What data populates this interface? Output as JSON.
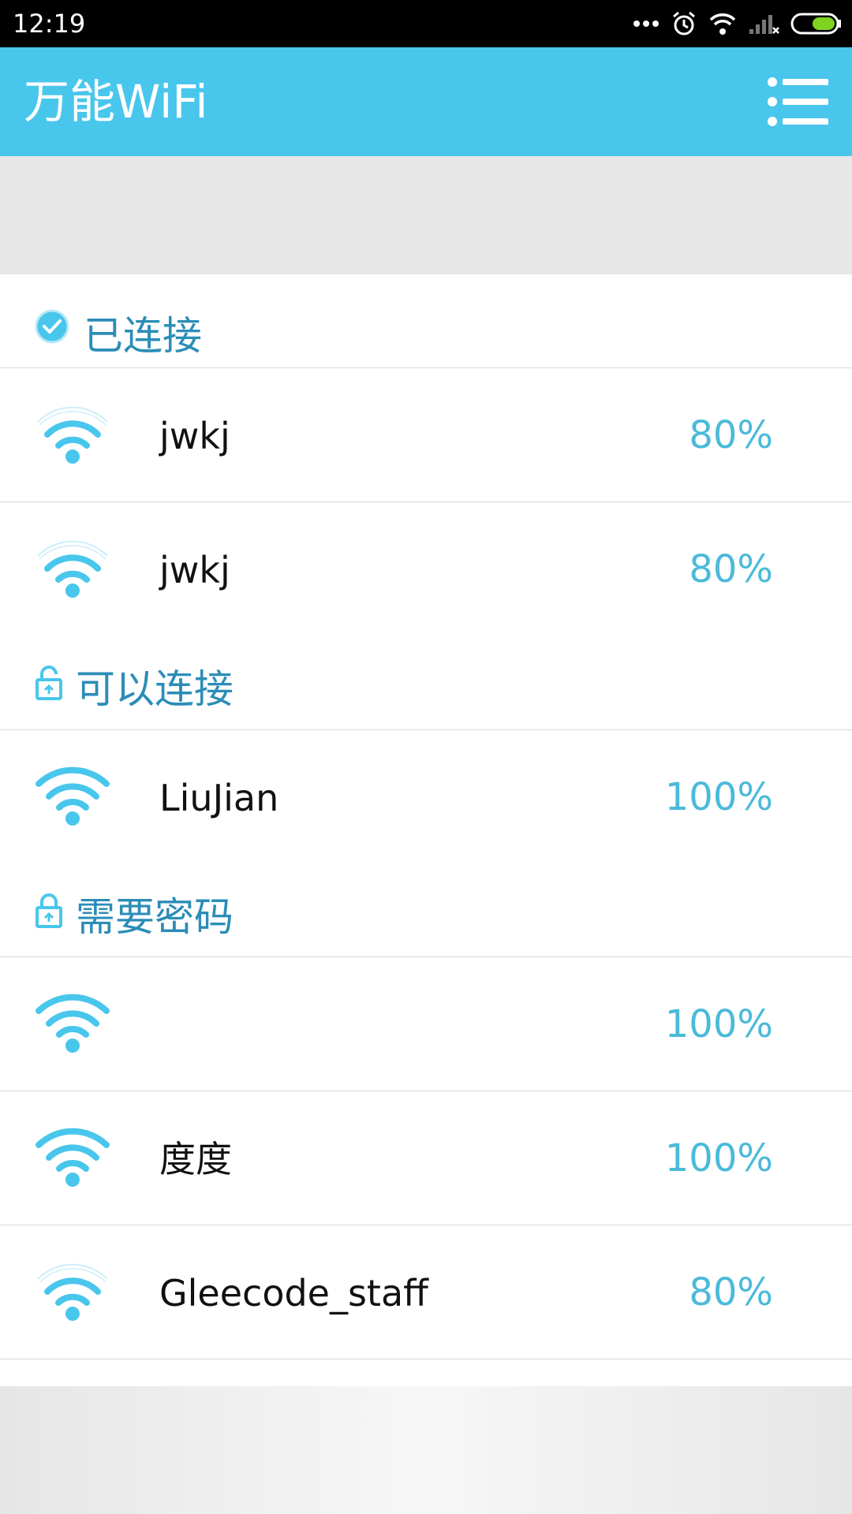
{
  "status_bar": {
    "time": "12:19",
    "icons": [
      "more-dots-icon",
      "alarm-icon",
      "wifi-status-icon",
      "cell-signal-icon",
      "battery-icon"
    ],
    "battery_color": "#7ed321"
  },
  "app_bar": {
    "title": "万能WiFi",
    "menu_icon": "menu-list-icon",
    "color": "#49c6ec"
  },
  "sections": {
    "connected": {
      "label": "已连接",
      "icon": "check-circle-icon",
      "networks": [
        {
          "name": "jwkj",
          "strength": "80%",
          "signal": 0.8
        },
        {
          "name": "jwkj",
          "strength": "80%",
          "signal": 0.8
        }
      ]
    },
    "open": {
      "label": "可以连接",
      "icon": "unlock-icon",
      "networks": [
        {
          "name": "LiuJian",
          "strength": "100%",
          "signal": 1.0
        }
      ]
    },
    "secured": {
      "label": "需要密码",
      "icon": "lock-icon",
      "networks": [
        {
          "name": "",
          "strength": "100%",
          "signal": 1.0
        },
        {
          "name": "度度",
          "strength": "100%",
          "signal": 1.0
        },
        {
          "name": "Gleecode_staff",
          "strength": "80%",
          "signal": 0.8
        }
      ]
    }
  },
  "colors": {
    "accent": "#49c6ec",
    "section_text": "#2b8db7",
    "strength_text": "#4bbad9"
  }
}
